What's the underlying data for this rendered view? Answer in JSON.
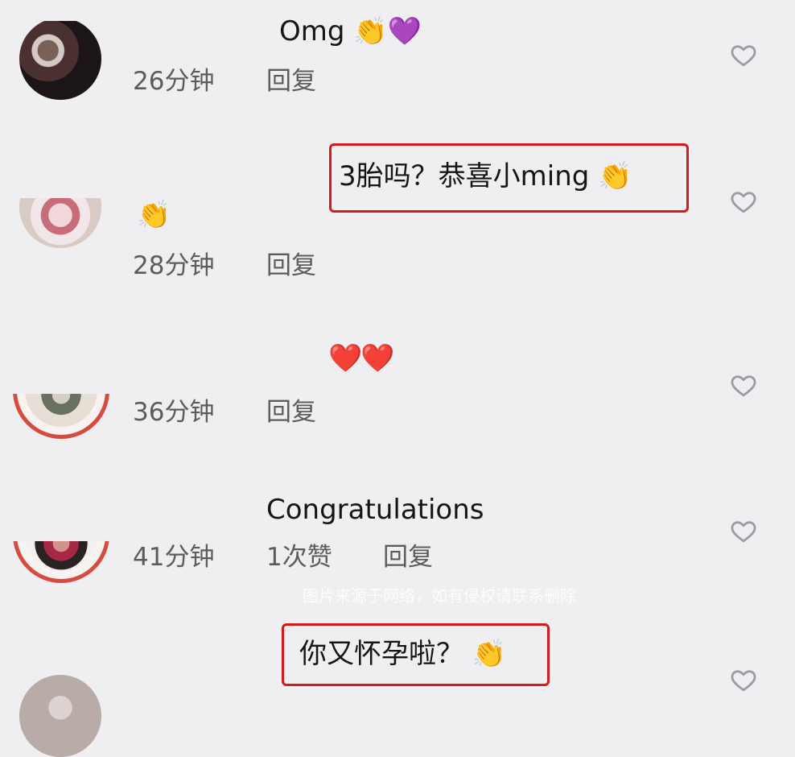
{
  "comments": [
    {
      "text": "Omg 👏💜",
      "time": "26分钟",
      "reply": "回复"
    },
    {
      "highlight_text": "3胎吗？恭喜小ming 👏",
      "text": "👏",
      "time": "28分钟",
      "reply": "回复"
    },
    {
      "text": "❤️❤️",
      "time": "36分钟",
      "reply": "回复"
    },
    {
      "text": "Congratulations",
      "time": "41分钟",
      "likes": "1次赞",
      "reply": "回复"
    },
    {
      "highlight_text": "你又怀孕啦？ 👏",
      "time": "",
      "likes": "",
      "reply": ""
    }
  ],
  "watermark": "图片来源于网络，如有侵权请联系删除",
  "icons": {
    "heart": "heart-outline-icon"
  },
  "colors": {
    "background": "#efeff1",
    "highlight_border": "#d51a1a",
    "meta_text": "#5c5c5f",
    "ring": "#d54b3f"
  }
}
